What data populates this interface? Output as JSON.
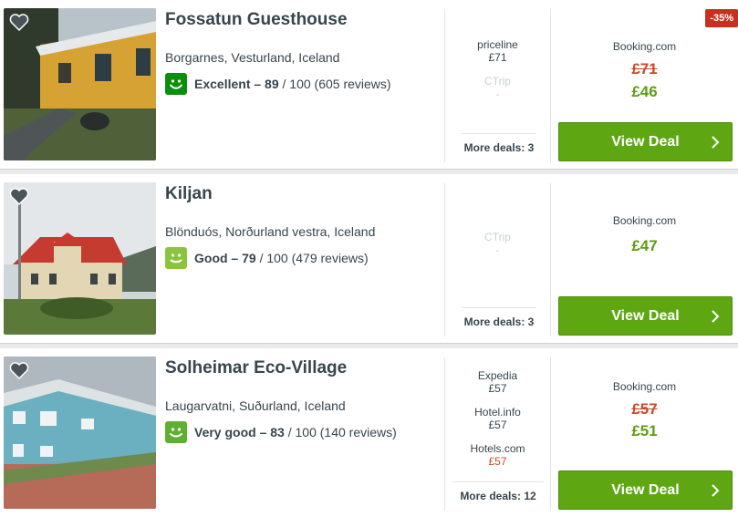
{
  "colors": {
    "accent_green": "#5ea713",
    "price_green": "#5c9e12",
    "strike_red": "#c94a2a",
    "badge_red": "#c6301e",
    "rating_excellent": "#0b8f0b",
    "rating_good": "#8ac43f"
  },
  "hotels": [
    {
      "name": "Fossatun Guesthouse",
      "location": "Borgarnes, Vesturland, Iceland",
      "rating_label": "Excellent – 89",
      "rating_rest": " / 100 (605 reviews)",
      "rating_icon": "smiley-icon-excellent",
      "deals": [
        {
          "site": "priceline",
          "price": "£71"
        },
        {
          "site": "CTrip",
          "price": "-"
        }
      ],
      "more_deals": "More deals: 3",
      "best_site": "Booking.com",
      "old_price": "£71",
      "new_price": "£46",
      "badge": "-35%",
      "cta": "View Deal"
    },
    {
      "name": "Kiljan",
      "location": "Blönduós, Norðurland vestra, Iceland",
      "rating_label": "Good – 79",
      "rating_rest": " / 100 (479 reviews)",
      "rating_icon": "smiley-icon-good",
      "deals": [
        {
          "site": "CTrip",
          "price": "-"
        }
      ],
      "more_deals": "More deals: 3",
      "best_site": "Booking.com",
      "new_price": "£47",
      "cta": "View Deal"
    },
    {
      "name": "Solheimar Eco-Village",
      "location": "Laugarvatni, Suðurland, Iceland",
      "rating_label": "Very good – 83",
      "rating_rest": " / 100 (140 reviews)",
      "rating_icon": "smiley-icon-very-good",
      "deals": [
        {
          "site": "Expedia",
          "price": "£57"
        },
        {
          "site": "Hotel.info",
          "price": "£57"
        },
        {
          "site": "Hotels.com",
          "price": "£57"
        }
      ],
      "more_deals": "More deals: 12",
      "best_site": "Booking.com",
      "old_price": "£57",
      "new_price": "£51",
      "cta": "View Deal"
    }
  ]
}
